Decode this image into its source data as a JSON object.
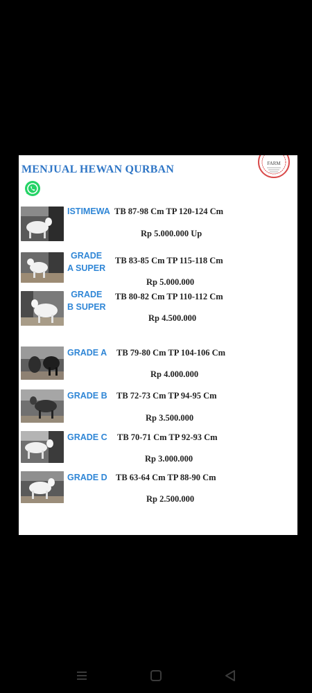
{
  "card": {
    "title": "MENJUAL HEWAN QURBAN",
    "stamp_text": "FARM",
    "contact_icon": "whatsapp-icon"
  },
  "items": [
    {
      "grade": "ISTIMEWA",
      "spec": "TB  87-98 Cm TP 120-124 Cm",
      "price": "Rp 5.000.000 Up"
    },
    {
      "grade_line1": "GRADE",
      "grade_line2": "A SUPER",
      "spec": "TB  83-85 Cm TP 115-118 Cm",
      "price": "Rp 5.000.000"
    },
    {
      "grade_line1": "GRADE",
      "grade_line2": "B SUPER",
      "spec": "TB  80-82 Cm TP 110-112 Cm",
      "price": "Rp 4.500.000"
    },
    {
      "grade": "GRADE A",
      "spec": "TB  79-80 Cm TP 104-106 Cm",
      "price": "Rp 4.000.000"
    },
    {
      "grade": "GRADE B",
      "spec": "TB  72-73 Cm TP 94-95 Cm",
      "price": "Rp 3.500.000"
    },
    {
      "grade": "GRADE C",
      "spec": "TB  70-71 Cm TP 92-93 Cm",
      "price": "Rp 3.000.000"
    },
    {
      "grade": "GRADE D",
      "spec": "TB  63-64 Cm TP 88-90 Cm",
      "price": "Rp 2.500.000"
    }
  ],
  "navbar": {
    "buttons": [
      "menu-icon",
      "home-icon",
      "back-icon"
    ]
  },
  "colors": {
    "background": "#000000",
    "card": "#ffffff",
    "title": "#2f76c6",
    "grade_label": "#2f86d6",
    "text": "#222222",
    "whatsapp": "#25d366"
  }
}
